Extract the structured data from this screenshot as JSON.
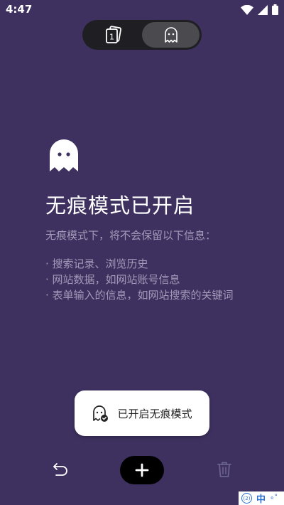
{
  "status_bar": {
    "time": "4:47"
  },
  "tabs": [
    {
      "name": "normal-tabs",
      "icon": "card-count-icon",
      "count": "1"
    },
    {
      "name": "incognito-tabs",
      "icon": "ghost-icon",
      "active": true
    }
  ],
  "incognito": {
    "title": "无痕模式已开启",
    "subtitle": "无痕模式下，将不会保留以下信息：",
    "items": [
      "· 搜索记录、浏览历史",
      "· 网站数据，如网站账号信息",
      "· 表单输入的信息，如网站搜索的关键词"
    ]
  },
  "toast": {
    "text": "已开启无痕模式"
  },
  "ime": {
    "badge": "(2)",
    "lang": "中"
  },
  "colors": {
    "background": "#3e3160",
    "tab_bg": "#1f1f23",
    "tab_active": "#4a4a4f",
    "secondary_text": "#a29ab8",
    "ime_accent": "#2b6fd1"
  }
}
